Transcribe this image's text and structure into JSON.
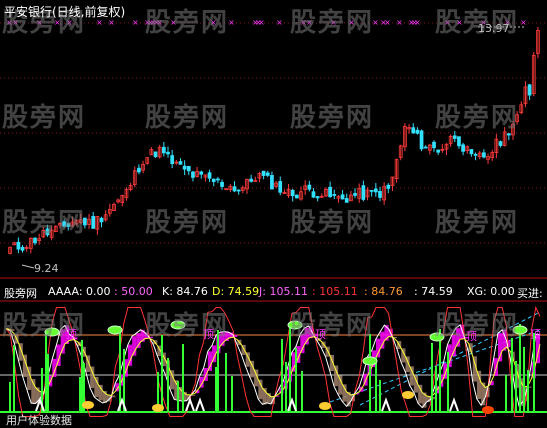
{
  "title": "平安银行(日线,前复权)",
  "price_high_label": "13.97",
  "price_low_label": "9.24",
  "watermark": "股旁网",
  "indicator_bar": {
    "name": "股旁网",
    "aaaa": "AAAA: 0.00",
    "val1": ": 50.00",
    "k": "K: 84.76",
    "d": "D: 74.59",
    "j": "J: 105.11",
    "val2": ": 105.11",
    "val3": ": 84.76",
    "val4": ": 74.59",
    "xg": "XG: 0.00",
    "buy": "买进:"
  },
  "top_labels": [
    "顶",
    "顶",
    "顶",
    "顶",
    "顶"
  ],
  "bottom_text": "用户体验数据",
  "colors": {
    "candle_up": "#ff3b3b",
    "candle_down": "#33e0ff",
    "k_line": "#ffffff",
    "d_line": "#ffff33",
    "j_line": "#ff33ff",
    "green_bar": "#33ff33",
    "magenta_area": "#ff00ff",
    "brown_area": "#a0806a"
  },
  "chart_data": [
    {
      "type": "candlestick",
      "title": "平安银行(日线,前复权)",
      "annotations": [
        "13.97",
        "9.24"
      ],
      "approx_close_trend": [
        9.5,
        9.6,
        9.8,
        9.9,
        10.1,
        10.0,
        10.3,
        10.6,
        11.3,
        11.5,
        11.2,
        11.0,
        10.9,
        10.8,
        10.7,
        11.0,
        10.8,
        10.6,
        10.7,
        10.6,
        10.5,
        10.6,
        10.6,
        10.7,
        12.0,
        11.6,
        11.5,
        11.8,
        11.3,
        11.4,
        11.8,
        12.3,
        13.97
      ]
    },
    {
      "type": "line",
      "title": "",
      "series": [
        {
          "name": "K",
          "last": 84.76
        },
        {
          "name": "D",
          "last": 74.59
        },
        {
          "name": "J",
          "last": 105.11
        }
      ]
    }
  ]
}
